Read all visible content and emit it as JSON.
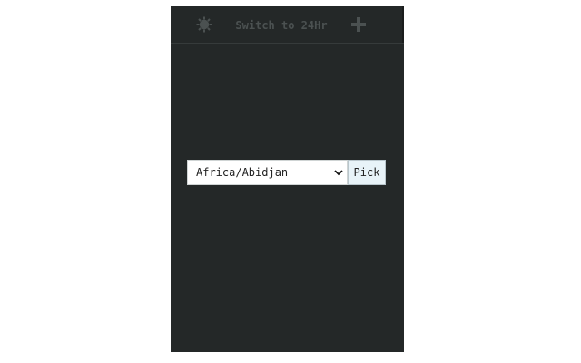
{
  "toolbar": {
    "theme_icon": "sun-gear-icon",
    "switch_label": "Switch to 24Hr",
    "add_icon": "plus-icon"
  },
  "picker": {
    "selected_timezone": "Africa/Abidjan",
    "pick_label": "Pick"
  },
  "colors": {
    "panel_bg": "#242828",
    "muted_text": "#4b5151",
    "button_bg": "#e8f3f8"
  }
}
